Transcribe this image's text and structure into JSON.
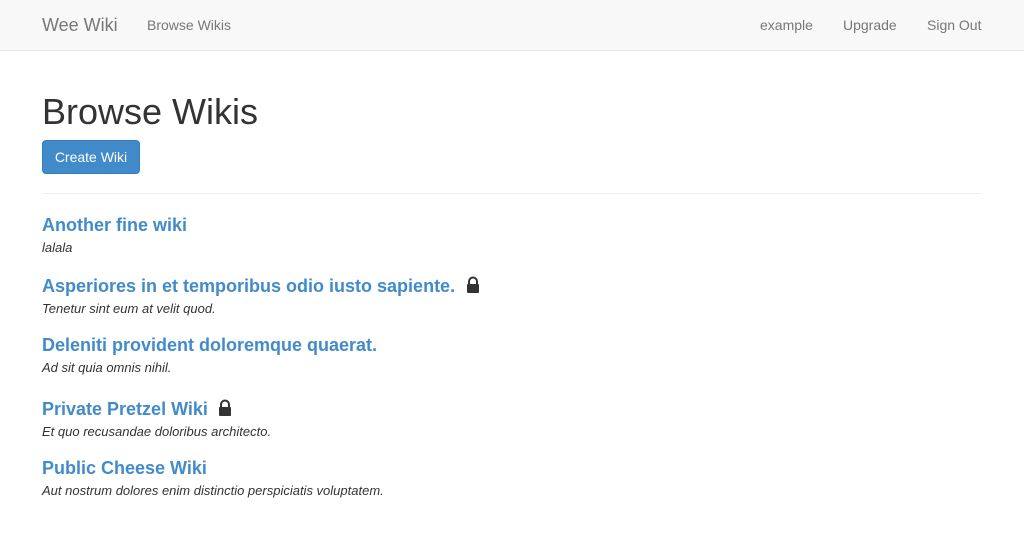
{
  "navbar": {
    "brand": "Wee Wiki",
    "browse_link": "Browse Wikis",
    "user_link": "example",
    "upgrade_link": "Upgrade",
    "signout_link": "Sign Out"
  },
  "main": {
    "title": "Browse Wikis",
    "create_button": "Create Wiki"
  },
  "wikis": [
    {
      "title": "Another fine wiki",
      "description": "lalala",
      "private": false
    },
    {
      "title": "Asperiores in et temporibus odio iusto sapiente.",
      "description": "Tenetur sint eum at velit quod.",
      "private": true
    },
    {
      "title": "Deleniti provident doloremque quaerat.",
      "description": "Ad sit quia omnis nihil.",
      "private": false
    },
    {
      "title": "Private Pretzel Wiki",
      "description": "Et quo recusandae doloribus architecto.",
      "private": true
    },
    {
      "title": "Public Cheese Wiki",
      "description": "Aut nostrum dolores enim distinctio perspiciatis voluptatem.",
      "private": false
    }
  ],
  "colors": {
    "link": "#428bca",
    "primary_button": "#428bca",
    "navbar_bg": "#f8f8f8",
    "lock_icon": "#333333"
  },
  "icons": {
    "private_marker": "lock-icon"
  }
}
